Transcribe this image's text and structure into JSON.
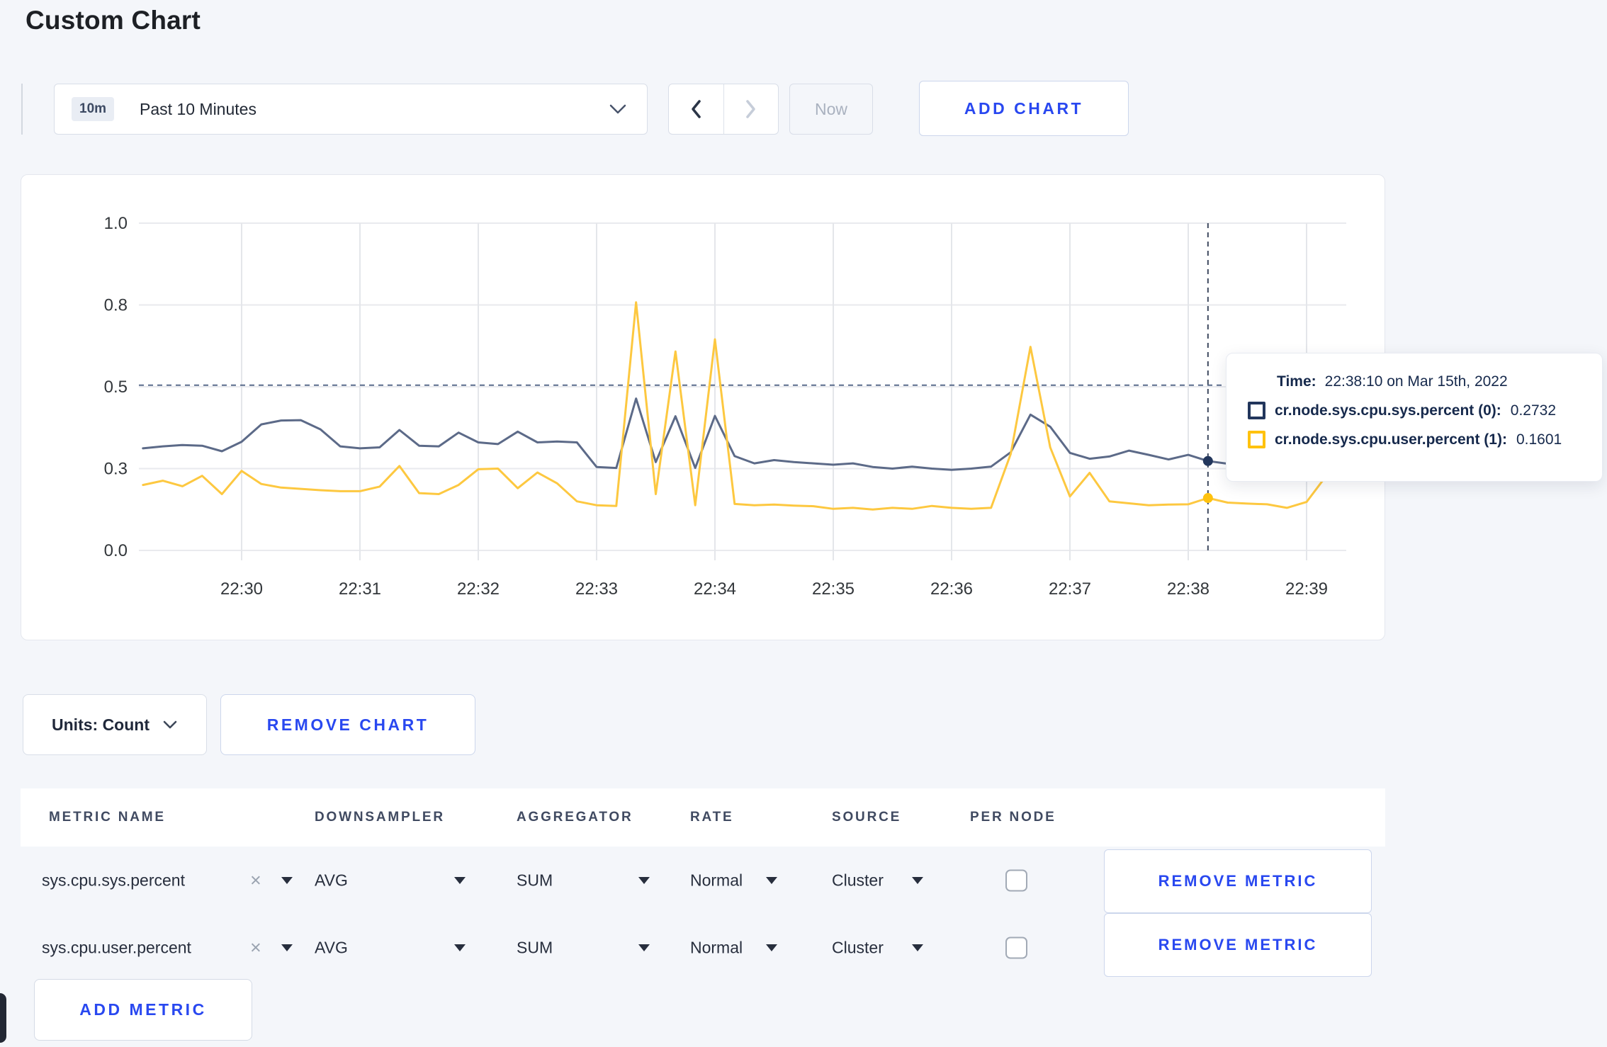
{
  "page": {
    "title": "Custom Chart",
    "background_color": "#f4f6fa",
    "accent_blue": "#2948f0"
  },
  "toolbar": {
    "time_range": {
      "badge": "10m",
      "label": "Past 10 Minutes"
    },
    "prev_enabled": true,
    "next_enabled": false,
    "now_label": "Now",
    "add_chart_label": "ADD CHART"
  },
  "icons": {
    "close": "×",
    "chevron_down": "v",
    "chevron_left": "<",
    "chevron_right": ">"
  },
  "chart_data": {
    "type": "line",
    "title": "",
    "xlabel": "",
    "ylabel": "",
    "ylim": [
      0,
      1
    ],
    "grid": true,
    "x_ticks": [
      "22:30",
      "22:31",
      "22:32",
      "22:33",
      "22:34",
      "22:35",
      "22:36",
      "22:37",
      "22:38",
      "22:39"
    ],
    "y_ticks": [
      {
        "label": "0.0",
        "value": 0
      },
      {
        "label": "0.3",
        "value": 0.25
      },
      {
        "label": "0.5",
        "value": 0.5
      },
      {
        "label": "0.8",
        "value": 0.75
      },
      {
        "label": "1.0",
        "value": 1.0
      }
    ],
    "hover": {
      "time": "22:38:10",
      "time_text": "22:38:10 on Mar 15th, 2022",
      "y_guide": 0.505,
      "values": [
        0.2732,
        0.1601
      ]
    },
    "series": [
      {
        "name": "cr.node.sys.cpu.sys.percent (0)",
        "color": "#5c6a88",
        "swatch_color": "#22365c",
        "points": [
          [
            "22:29:10",
            0.312
          ],
          [
            "22:29:20",
            0.318
          ],
          [
            "22:29:30",
            0.322
          ],
          [
            "22:29:40",
            0.32
          ],
          [
            "22:29:50",
            0.303
          ],
          [
            "22:30:00",
            0.332
          ],
          [
            "22:30:10",
            0.385
          ],
          [
            "22:30:20",
            0.397
          ],
          [
            "22:30:30",
            0.398
          ],
          [
            "22:30:40",
            0.37
          ],
          [
            "22:30:50",
            0.318
          ],
          [
            "22:31:00",
            0.312
          ],
          [
            "22:31:10",
            0.315
          ],
          [
            "22:31:20",
            0.368
          ],
          [
            "22:31:30",
            0.32
          ],
          [
            "22:31:40",
            0.318
          ],
          [
            "22:31:50",
            0.36
          ],
          [
            "22:32:00",
            0.33
          ],
          [
            "22:32:10",
            0.325
          ],
          [
            "22:32:20",
            0.363
          ],
          [
            "22:32:30",
            0.33
          ],
          [
            "22:32:40",
            0.333
          ],
          [
            "22:32:50",
            0.33
          ],
          [
            "22:33:00",
            0.255
          ],
          [
            "22:33:10",
            0.252
          ],
          [
            "22:33:20",
            0.464
          ],
          [
            "22:33:30",
            0.27
          ],
          [
            "22:33:40",
            0.41
          ],
          [
            "22:33:50",
            0.252
          ],
          [
            "22:34:00",
            0.411
          ],
          [
            "22:34:10",
            0.288
          ],
          [
            "22:34:20",
            0.266
          ],
          [
            "22:34:30",
            0.276
          ],
          [
            "22:34:40",
            0.27
          ],
          [
            "22:34:50",
            0.266
          ],
          [
            "22:35:00",
            0.262
          ],
          [
            "22:35:10",
            0.266
          ],
          [
            "22:35:20",
            0.255
          ],
          [
            "22:35:30",
            0.25
          ],
          [
            "22:35:40",
            0.256
          ],
          [
            "22:35:50",
            0.25
          ],
          [
            "22:36:00",
            0.246
          ],
          [
            "22:36:10",
            0.25
          ],
          [
            "22:36:20",
            0.256
          ],
          [
            "22:36:30",
            0.3
          ],
          [
            "22:36:40",
            0.415
          ],
          [
            "22:36:50",
            0.378
          ],
          [
            "22:37:00",
            0.298
          ],
          [
            "22:37:10",
            0.28
          ],
          [
            "22:37:20",
            0.287
          ],
          [
            "22:37:30",
            0.305
          ],
          [
            "22:37:40",
            0.292
          ],
          [
            "22:37:50",
            0.278
          ],
          [
            "22:38:00",
            0.292
          ],
          [
            "22:38:10",
            0.2732
          ],
          [
            "22:38:20",
            0.265
          ],
          [
            "22:38:30",
            0.27
          ],
          [
            "22:38:40",
            0.287
          ],
          [
            "22:38:50",
            0.272
          ],
          [
            "22:39:00",
            0.265
          ],
          [
            "22:39:10",
            0.278
          ],
          [
            "22:39:20",
            0.281
          ]
        ]
      },
      {
        "name": "cr.node.sys.cpu.user.percent (1)",
        "color": "#fdc840",
        "swatch_color": "#ffc20e",
        "points": [
          [
            "22:29:10",
            0.2
          ],
          [
            "22:29:20",
            0.213
          ],
          [
            "22:29:30",
            0.196
          ],
          [
            "22:29:40",
            0.228
          ],
          [
            "22:29:50",
            0.172
          ],
          [
            "22:30:00",
            0.243
          ],
          [
            "22:30:10",
            0.203
          ],
          [
            "22:30:20",
            0.192
          ],
          [
            "22:30:30",
            0.188
          ],
          [
            "22:30:40",
            0.184
          ],
          [
            "22:30:50",
            0.181
          ],
          [
            "22:31:00",
            0.181
          ],
          [
            "22:31:10",
            0.195
          ],
          [
            "22:31:20",
            0.258
          ],
          [
            "22:31:30",
            0.175
          ],
          [
            "22:31:40",
            0.172
          ],
          [
            "22:31:50",
            0.2
          ],
          [
            "22:32:00",
            0.248
          ],
          [
            "22:32:10",
            0.25
          ],
          [
            "22:32:20",
            0.19
          ],
          [
            "22:32:30",
            0.238
          ],
          [
            "22:32:40",
            0.205
          ],
          [
            "22:32:50",
            0.15
          ],
          [
            "22:33:00",
            0.138
          ],
          [
            "22:33:10",
            0.136
          ],
          [
            "22:33:20",
            0.758
          ],
          [
            "22:33:30",
            0.172
          ],
          [
            "22:33:40",
            0.608
          ],
          [
            "22:33:50",
            0.138
          ],
          [
            "22:34:00",
            0.645
          ],
          [
            "22:34:10",
            0.142
          ],
          [
            "22:34:20",
            0.138
          ],
          [
            "22:34:30",
            0.14
          ],
          [
            "22:34:40",
            0.137
          ],
          [
            "22:34:50",
            0.135
          ],
          [
            "22:35:00",
            0.127
          ],
          [
            "22:35:10",
            0.13
          ],
          [
            "22:35:20",
            0.125
          ],
          [
            "22:35:30",
            0.13
          ],
          [
            "22:35:40",
            0.127
          ],
          [
            "22:35:50",
            0.136
          ],
          [
            "22:36:00",
            0.13
          ],
          [
            "22:36:10",
            0.127
          ],
          [
            "22:36:20",
            0.13
          ],
          [
            "22:36:30",
            0.295
          ],
          [
            "22:36:40",
            0.622
          ],
          [
            "22:36:50",
            0.315
          ],
          [
            "22:37:00",
            0.165
          ],
          [
            "22:37:10",
            0.237
          ],
          [
            "22:37:20",
            0.15
          ],
          [
            "22:37:30",
            0.144
          ],
          [
            "22:37:40",
            0.138
          ],
          [
            "22:37:50",
            0.14
          ],
          [
            "22:38:00",
            0.141
          ],
          [
            "22:38:10",
            0.1601
          ],
          [
            "22:38:20",
            0.146
          ],
          [
            "22:38:30",
            0.143
          ],
          [
            "22:38:40",
            0.141
          ],
          [
            "22:38:50",
            0.13
          ],
          [
            "22:39:00",
            0.148
          ],
          [
            "22:39:10",
            0.228
          ],
          [
            "22:39:20",
            0.213
          ]
        ]
      }
    ]
  },
  "tooltip": {
    "time_label": "Time:",
    "time_value": "22:38:10 on Mar 15th, 2022",
    "rows": [
      {
        "label": "cr.node.sys.cpu.sys.percent (0):",
        "value": "0.2732"
      },
      {
        "label": "cr.node.sys.cpu.user.percent (1):",
        "value": "0.1601"
      }
    ]
  },
  "chart_controls": {
    "units_label": "Units: Count",
    "remove_chart_label": "REMOVE CHART"
  },
  "metrics_table": {
    "headers": [
      "METRIC NAME",
      "DOWNSAMPLER",
      "AGGREGATOR",
      "RATE",
      "SOURCE",
      "PER NODE"
    ],
    "rows": [
      {
        "metric": "sys.cpu.sys.percent",
        "downsampler": "AVG",
        "aggregator": "SUM",
        "rate": "Normal",
        "source": "Cluster",
        "per_node": false,
        "remove_label": "REMOVE METRIC"
      },
      {
        "metric": "sys.cpu.user.percent",
        "downsampler": "AVG",
        "aggregator": "SUM",
        "rate": "Normal",
        "source": "Cluster",
        "per_node": false,
        "remove_label": "REMOVE METRIC"
      }
    ],
    "add_metric_label": "ADD METRIC"
  }
}
